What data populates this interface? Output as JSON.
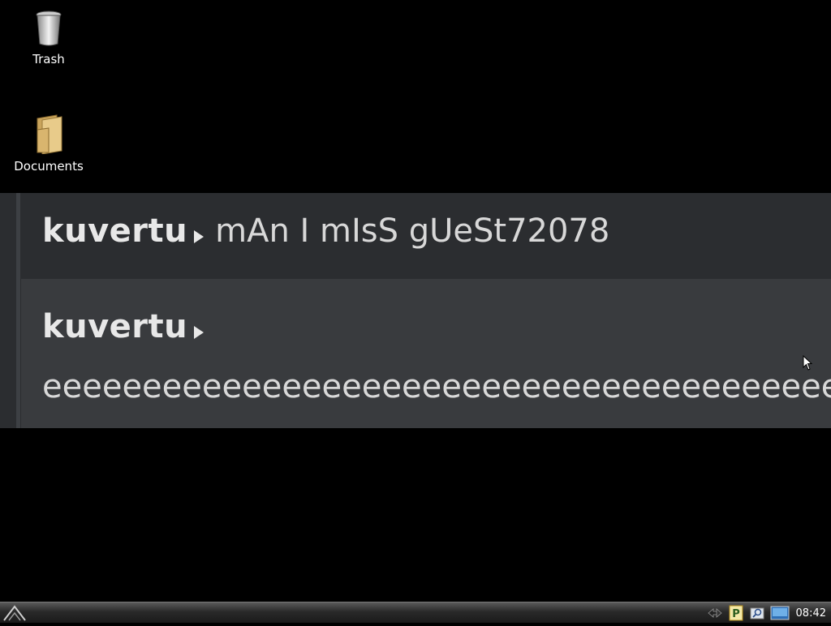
{
  "desktop": {
    "icons": [
      {
        "label": "Trash",
        "icon": "trash-icon"
      },
      {
        "label": "Documents",
        "icon": "folder-icon"
      }
    ]
  },
  "chat": {
    "messages": [
      {
        "author": "kuvertu",
        "text": "mAn I mIsS gUeSt72078"
      },
      {
        "author": "kuvertu",
        "text": "eeeeeeeeeeeeeeeeeeeeeeeeeeeeeeeeeeeeeeeeeeeeeeeeeeeeeee"
      }
    ]
  },
  "taskbar": {
    "start_icon": "start-menu-icon",
    "tray": [
      "network-icon",
      "pidgin-icon",
      "search-icon",
      "display-icon"
    ],
    "clock": "08:42"
  },
  "colors": {
    "desktop_bg": "#000000",
    "chat_bg": "#2b2d30",
    "chat_highlight_bg": "#393b3e",
    "text": "#e4e4e4"
  }
}
